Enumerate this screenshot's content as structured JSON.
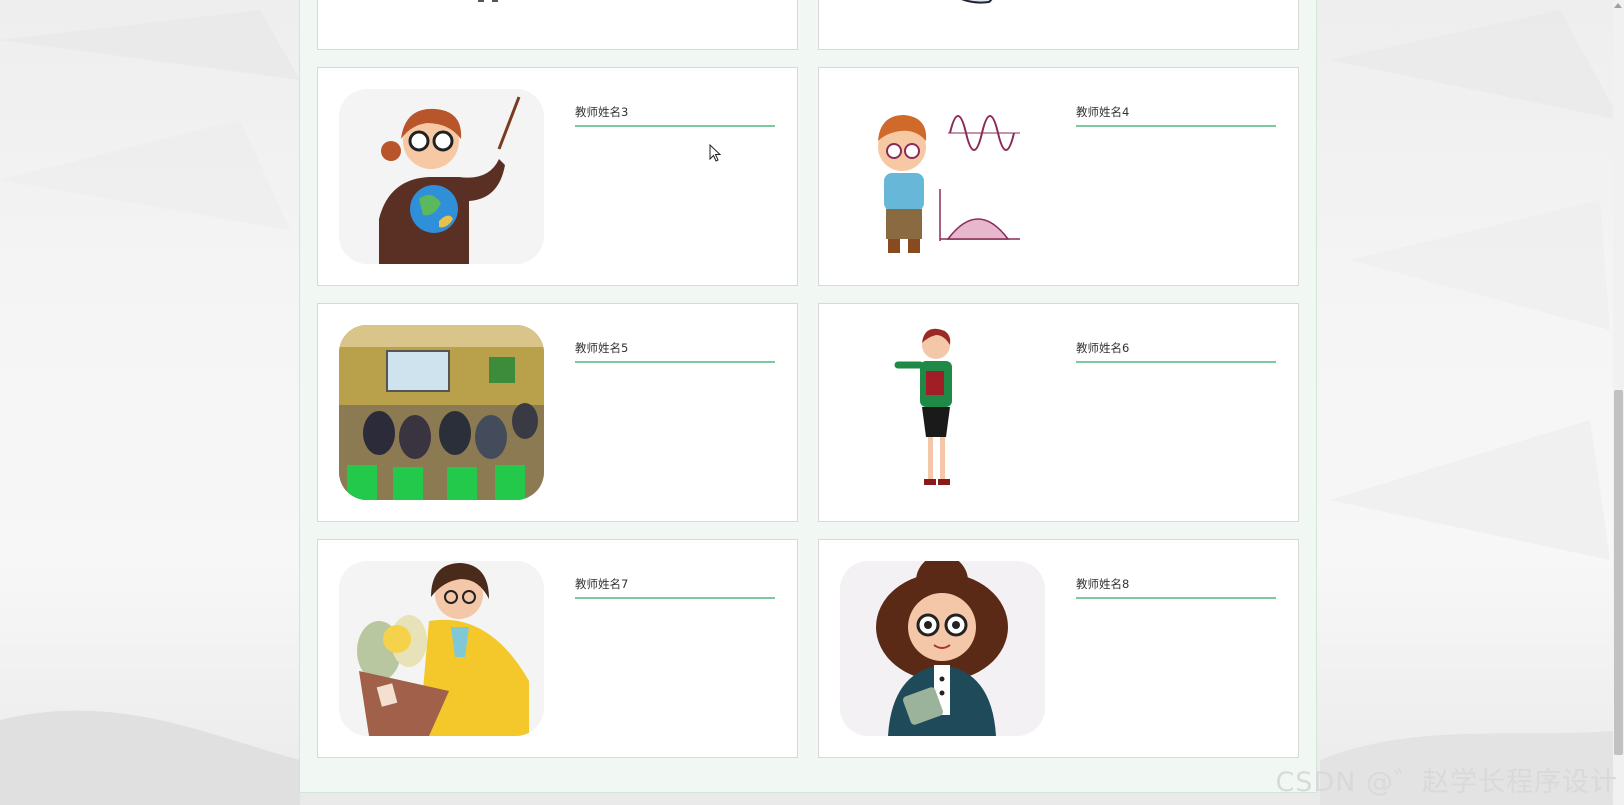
{
  "teachers": [
    {
      "name": "教师姓名3",
      "photo": "teacher-with-globe-icon"
    },
    {
      "name": "教师姓名4",
      "photo": "boy-with-math-graphs-icon"
    },
    {
      "name": "教师姓名5",
      "photo": "classroom-meeting-photo"
    },
    {
      "name": "教师姓名6",
      "photo": "teacher-holding-book-icon"
    },
    {
      "name": "教师姓名7",
      "photo": "teacher-with-flowers-icon"
    },
    {
      "name": "教师姓名8",
      "photo": "teacher-with-glasses-icon"
    }
  ],
  "watermark": "CSDN @゛赵学长程序设计",
  "colors": {
    "accent_underline": "#7cc9a0",
    "panel_bg": "#f1f8f4",
    "card_border": "#d8d8d8"
  }
}
